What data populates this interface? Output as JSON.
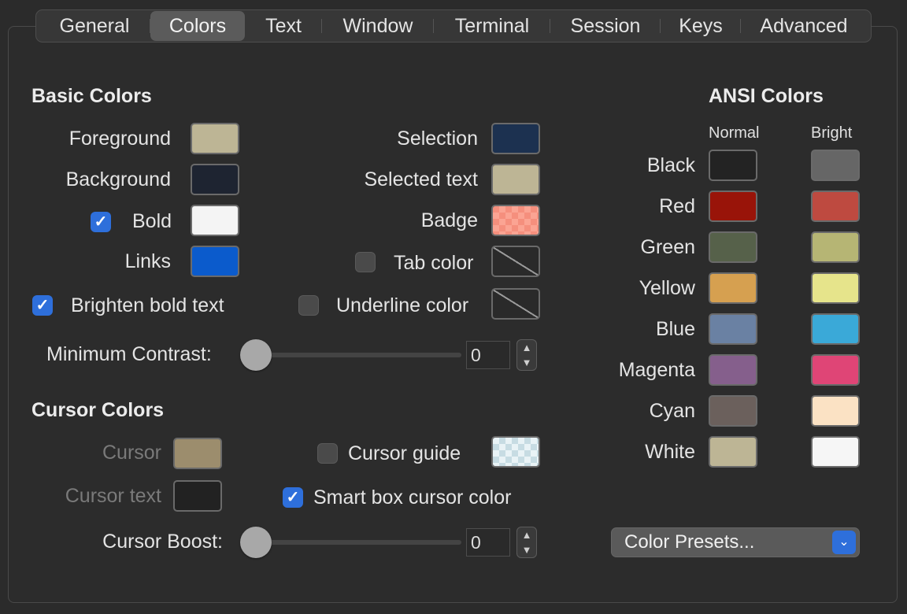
{
  "tabs": [
    {
      "label": "General",
      "selected": false
    },
    {
      "label": "Colors",
      "selected": true
    },
    {
      "label": "Text",
      "selected": false
    },
    {
      "label": "Window",
      "selected": false
    },
    {
      "label": "Terminal",
      "selected": false
    },
    {
      "label": "Session",
      "selected": false
    },
    {
      "label": "Keys",
      "selected": false
    },
    {
      "label": "Advanced",
      "selected": false
    }
  ],
  "basic": {
    "title": "Basic Colors",
    "foreground_label": "Foreground",
    "foreground_color": "#bdb595",
    "background_label": "Background",
    "background_color": "#1e2431",
    "bold_label": "Bold",
    "bold_checked": true,
    "bold_color": "#f4f4f4",
    "links_label": "Links",
    "links_color": "#0b5bcc",
    "selection_label": "Selection",
    "selection_color": "#1c3150",
    "selected_text_label": "Selected text",
    "selected_text_color": "#bdb595",
    "badge_label": "Badge",
    "badge_color": "#f58f7d",
    "tab_color_label": "Tab color",
    "tab_color_checked": false,
    "brighten_label": "Brighten bold text",
    "brighten_checked": true,
    "underline_label": "Underline color",
    "underline_checked": false,
    "min_contrast_label": "Minimum Contrast:",
    "min_contrast_value": "0"
  },
  "cursor": {
    "title": "Cursor Colors",
    "cursor_label": "Cursor",
    "cursor_color": "#9c8d6d",
    "cursor_text_label": "Cursor text",
    "cursor_text_color": "#222222",
    "guide_label": "Cursor guide",
    "guide_checked": false,
    "smart_label": "Smart box cursor color",
    "smart_checked": true,
    "boost_label": "Cursor Boost:",
    "boost_value": "0"
  },
  "ansi": {
    "title": "ANSI Colors",
    "normal_header": "Normal",
    "bright_header": "Bright",
    "rows": [
      {
        "label": "Black",
        "normal": "#232323",
        "bright": "#666666"
      },
      {
        "label": "Red",
        "normal": "#991409",
        "bright": "#be4a40"
      },
      {
        "label": "Green",
        "normal": "#56614a",
        "bright": "#b6b574"
      },
      {
        "label": "Yellow",
        "normal": "#d6a050",
        "bright": "#e6e48b"
      },
      {
        "label": "Blue",
        "normal": "#6a81a3",
        "bright": "#3aa9d8"
      },
      {
        "label": "Magenta",
        "normal": "#855f8c",
        "bright": "#df4576"
      },
      {
        "label": "Cyan",
        "normal": "#6b605c",
        "bright": "#fbe2c4"
      },
      {
        "label": "White",
        "normal": "#bdb595",
        "bright": "#f6f6f6"
      }
    ]
  },
  "presets": {
    "label": "Color Presets...",
    "icon": "chevron-down-icon"
  }
}
